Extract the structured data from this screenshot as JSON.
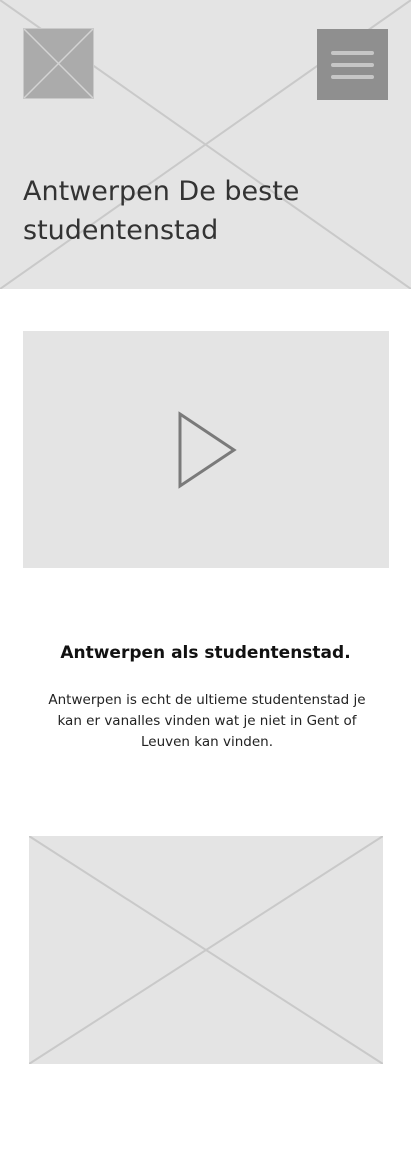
{
  "hero": {
    "title": "Antwerpen De beste studentenstad",
    "logo_icon": "image-placeholder-icon",
    "menu_icon": "hamburger-menu-icon"
  },
  "video": {
    "icon": "play-icon"
  },
  "intro": {
    "heading": "Antwerpen als studentenstad.",
    "body": "Antwerpen is echt de ultieme studentenstad je kan er vanalles vinden wat je niet in Gent of Leuven kan vinden."
  },
  "image": {
    "icon": "image-placeholder-icon"
  },
  "colors": {
    "placeholder_bg": "#e4e4e4",
    "placeholder_line": "#c9c9c9",
    "menu_bg": "#8f8f8f",
    "title_text": "#333333"
  }
}
